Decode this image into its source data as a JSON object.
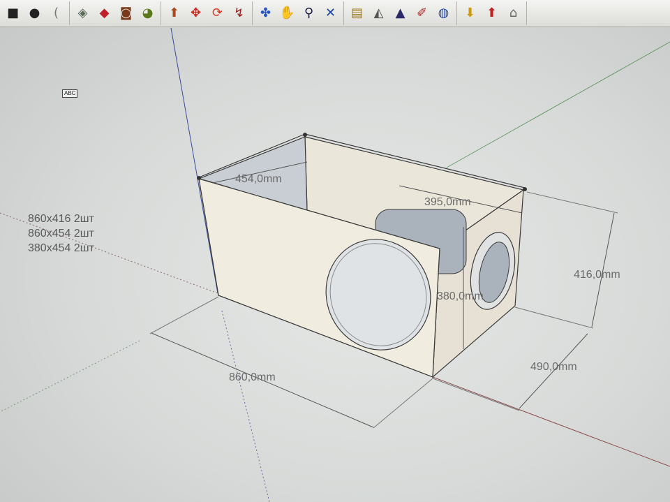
{
  "toolbar": {
    "groups": [
      [
        {
          "name": "square-tool-icon",
          "glyph": "■",
          "color": "#222222"
        },
        {
          "name": "circle-tool-icon",
          "glyph": "●",
          "color": "#222222"
        },
        {
          "name": "arc-tool-icon",
          "glyph": "(",
          "color": "#777777"
        }
      ],
      [
        {
          "name": "offset-tool-icon",
          "glyph": "◈",
          "color": "#5a6a5a"
        },
        {
          "name": "eraser-tool-icon",
          "glyph": "◆",
          "color": "#c0202a"
        },
        {
          "name": "tape-measure-icon",
          "glyph": "◙",
          "color": "#7a3a1a"
        },
        {
          "name": "paint-bucket-icon",
          "glyph": "◕",
          "color": "#5a7a1a"
        }
      ],
      [
        {
          "name": "push-pull-icon",
          "glyph": "⬆",
          "color": "#a84a20"
        },
        {
          "name": "move-tool-icon",
          "glyph": "✥",
          "color": "#c42a20"
        },
        {
          "name": "rotate-tool-icon",
          "glyph": "⟳",
          "color": "#d23a20"
        },
        {
          "name": "follow-me-icon",
          "glyph": "↯",
          "color": "#9a2020"
        }
      ],
      [
        {
          "name": "orbit-tool-icon",
          "glyph": "✤",
          "color": "#2a55c0"
        },
        {
          "name": "pan-hand-icon",
          "glyph": "✋",
          "color": "#555555"
        },
        {
          "name": "zoom-magnifier-icon",
          "glyph": "⚲",
          "color": "#1a1a40"
        },
        {
          "name": "zoom-extents-icon",
          "glyph": "✕",
          "color": "#1a40a0"
        }
      ],
      [
        {
          "name": "model-info-icon",
          "glyph": "▤",
          "color": "#a07a1a"
        },
        {
          "name": "position-camera-icon",
          "glyph": "◭",
          "color": "#555555"
        },
        {
          "name": "look-around-icon",
          "glyph": "▲",
          "color": "#2a2a6a"
        },
        {
          "name": "walk-tool-icon",
          "glyph": "✐",
          "color": "#b02020"
        },
        {
          "name": "globe-icon",
          "glyph": "◍",
          "color": "#2a4aa0"
        }
      ],
      [
        {
          "name": "get-models-icon",
          "glyph": "⬇",
          "color": "#d09a10"
        },
        {
          "name": "share-model-icon",
          "glyph": "⬆",
          "color": "#c02020"
        },
        {
          "name": "components-3d-icon",
          "glyph": "⌂",
          "color": "#666666"
        }
      ]
    ]
  },
  "text_tag": "ABC",
  "parts_note": [
    "860x416 2шт",
    "860x454 2шт",
    "380x454 2шт"
  ],
  "dimensions": {
    "inner_depth": "454,0mm",
    "inner_length": "395,0mm",
    "height": "416,0mm",
    "panel_width": "380,0mm",
    "depth": "490,0mm",
    "length": "860,0mm"
  },
  "colors": {
    "panel_face": "#f1ece0",
    "panel_shadow": "#dcd6ca",
    "inner_wall": "#e5dfd4",
    "pipe": "#aab2bb",
    "blue_axis": "#3a4a9a",
    "green_axis": "#6a9a6a",
    "red_axis": "#8a4a4a"
  }
}
